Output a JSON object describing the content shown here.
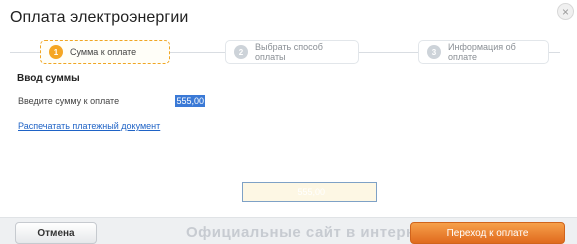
{
  "dialog": {
    "title": "Оплата электроэнергии",
    "close_symbol": "×"
  },
  "steps": [
    {
      "number": "1",
      "label": "Сумма к оплате",
      "state": "active"
    },
    {
      "number": "2",
      "label": "Выбрать способ оплаты",
      "state": "inactive"
    },
    {
      "number": "3",
      "label": "Информация об оплате",
      "state": "inactive"
    }
  ],
  "form": {
    "section_title": "Ввод суммы",
    "amount_label": "Введите сумму к оплате",
    "amount_value": "555,00",
    "print_link": "Распечатать платежный документ"
  },
  "footer": {
    "cancel_label": "Отмена",
    "next_label": "Переход к оплате",
    "watermark": "Официальные сайт в интернете Offisite.ru"
  },
  "colors": {
    "accent": "#f5a623",
    "primary_button": "#e8792b",
    "link": "#1f63c6"
  },
  "icons": {
    "close": "close-icon"
  }
}
